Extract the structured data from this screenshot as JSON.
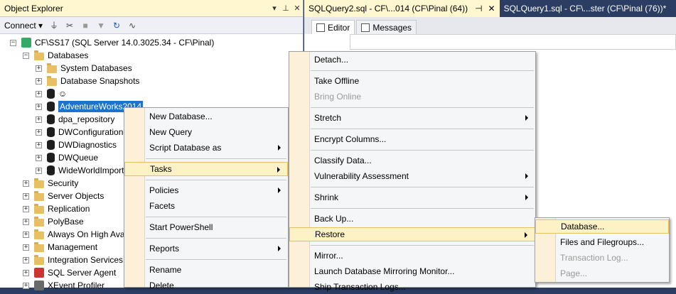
{
  "object_explorer": {
    "title": "Object Explorer",
    "title_buttons": [
      "▾",
      "⊥",
      "✕"
    ],
    "toolbar": {
      "connect_label": "Connect ▾"
    },
    "tree": [
      {
        "label": "CF\\SS17 (SQL Server 14.0.3025.34 - CF\\Pinal)",
        "indent": 0,
        "expander": "−",
        "icon": "server-icon"
      },
      {
        "label": "Databases",
        "indent": 1,
        "expander": "−",
        "icon": "folder-icon"
      },
      {
        "label": "System Databases",
        "indent": 2,
        "expander": "+",
        "icon": "folder-icon"
      },
      {
        "label": "Database Snapshots",
        "indent": 2,
        "expander": "+",
        "icon": "folder-icon"
      },
      {
        "label": "☺",
        "indent": 2,
        "expander": "+",
        "icon": "database-icon"
      },
      {
        "label": "AdventureWorks2014",
        "indent": 2,
        "expander": "+",
        "icon": "database-icon",
        "selected": true
      },
      {
        "label": "dpa_repository",
        "indent": 2,
        "expander": "+",
        "icon": "database-icon"
      },
      {
        "label": "DWConfiguration",
        "indent": 2,
        "expander": "+",
        "icon": "database-icon"
      },
      {
        "label": "DWDiagnostics",
        "indent": 2,
        "expander": "+",
        "icon": "database-icon"
      },
      {
        "label": "DWQueue",
        "indent": 2,
        "expander": "+",
        "icon": "database-icon"
      },
      {
        "label": "WideWorldImporters",
        "indent": 2,
        "expander": "+",
        "icon": "database-icon"
      },
      {
        "label": "Security",
        "indent": 1,
        "expander": "+",
        "icon": "folder-icon"
      },
      {
        "label": "Server Objects",
        "indent": 1,
        "expander": "+",
        "icon": "folder-icon"
      },
      {
        "label": "Replication",
        "indent": 1,
        "expander": "+",
        "icon": "folder-icon"
      },
      {
        "label": "PolyBase",
        "indent": 1,
        "expander": "+",
        "icon": "folder-icon"
      },
      {
        "label": "Always On High Availability",
        "indent": 1,
        "expander": "+",
        "icon": "folder-icon"
      },
      {
        "label": "Management",
        "indent": 1,
        "expander": "+",
        "icon": "folder-icon"
      },
      {
        "label": "Integration Services Catalogs",
        "indent": 1,
        "expander": "+",
        "icon": "folder-icon"
      },
      {
        "label": "SQL Server Agent",
        "indent": 1,
        "expander": "+",
        "icon": "agent-icon"
      },
      {
        "label": "XEvent Profiler",
        "indent": 1,
        "expander": "+",
        "icon": "profiler-icon"
      }
    ]
  },
  "document_tabs": [
    {
      "label": "SQLQuery2.sql - CF\\...014 (CF\\Pinal (64))",
      "pin": "⊣",
      "close": "✕",
      "active": true
    },
    {
      "label": "SQLQuery1.sql - CF\\...ster (CF\\Pinal (76))*",
      "active": false
    }
  ],
  "result_tabs": [
    {
      "label": "Editor",
      "active": true
    },
    {
      "label": "Messages",
      "active": false
    }
  ],
  "menu1": {
    "items": [
      {
        "label": "New Database..."
      },
      {
        "label": "New Query"
      },
      {
        "label": "Script Database as",
        "submenu": true
      },
      {
        "sep": true
      },
      {
        "label": "Tasks",
        "submenu": true,
        "highlight": true
      },
      {
        "sep": true
      },
      {
        "label": "Policies",
        "submenu": true
      },
      {
        "label": "Facets"
      },
      {
        "sep": true
      },
      {
        "label": "Start PowerShell"
      },
      {
        "sep": true
      },
      {
        "label": "Reports",
        "submenu": true
      },
      {
        "sep": true
      },
      {
        "label": "Rename"
      },
      {
        "label": "Delete"
      }
    ]
  },
  "menu2": {
    "items": [
      {
        "label": "Detach..."
      },
      {
        "sep": true
      },
      {
        "label": "Take Offline"
      },
      {
        "label": "Bring Online",
        "disabled": true
      },
      {
        "sep": true
      },
      {
        "label": "Stretch",
        "submenu": true
      },
      {
        "sep": true
      },
      {
        "label": "Encrypt Columns..."
      },
      {
        "sep": true
      },
      {
        "label": "Classify Data..."
      },
      {
        "label": "Vulnerability Assessment",
        "submenu": true
      },
      {
        "sep": true
      },
      {
        "label": "Shrink",
        "submenu": true
      },
      {
        "sep": true
      },
      {
        "label": "Back Up..."
      },
      {
        "label": "Restore",
        "submenu": true,
        "highlight": true
      },
      {
        "sep": true
      },
      {
        "label": "Mirror..."
      },
      {
        "label": "Launch Database Mirroring Monitor..."
      },
      {
        "label": "Ship Transaction Logs..."
      }
    ]
  },
  "menu3": {
    "items": [
      {
        "label": "Database...",
        "highlight": true
      },
      {
        "label": "Files and Filegroups..."
      },
      {
        "label": "Transaction Log...",
        "disabled": true
      },
      {
        "label": "Page...",
        "disabled": true
      }
    ]
  }
}
